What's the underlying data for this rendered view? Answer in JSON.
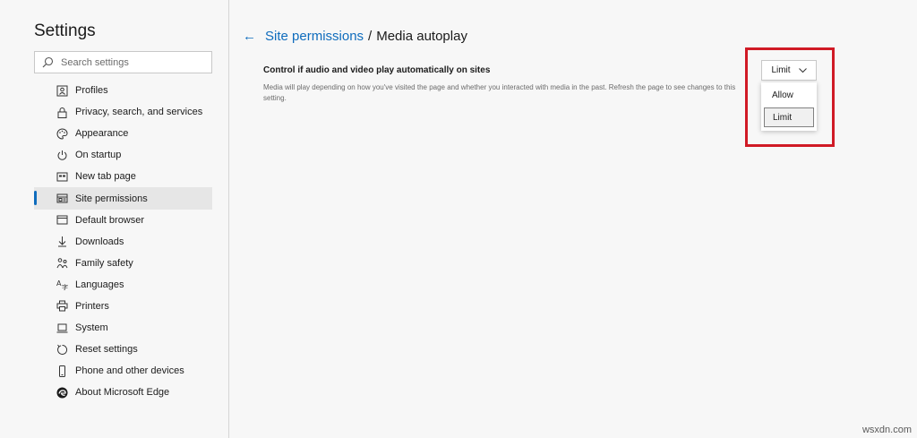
{
  "sidebar": {
    "title": "Settings",
    "search": {
      "placeholder": "Search settings",
      "icon": "search-icon"
    },
    "items": [
      {
        "label": "Profiles",
        "icon": "profile-icon",
        "active": false
      },
      {
        "label": "Privacy, search, and services",
        "icon": "lock-icon",
        "active": false
      },
      {
        "label": "Appearance",
        "icon": "palette-icon",
        "active": false
      },
      {
        "label": "On startup",
        "icon": "power-icon",
        "active": false
      },
      {
        "label": "New tab page",
        "icon": "new-tab-icon",
        "active": false
      },
      {
        "label": "Site permissions",
        "icon": "site-permissions-icon",
        "active": true
      },
      {
        "label": "Default browser",
        "icon": "browser-icon",
        "active": false
      },
      {
        "label": "Downloads",
        "icon": "download-icon",
        "active": false
      },
      {
        "label": "Family safety",
        "icon": "family-icon",
        "active": false
      },
      {
        "label": "Languages",
        "icon": "languages-icon",
        "active": false
      },
      {
        "label": "Printers",
        "icon": "printer-icon",
        "active": false
      },
      {
        "label": "System",
        "icon": "system-icon",
        "active": false
      },
      {
        "label": "Reset settings",
        "icon": "reset-icon",
        "active": false
      },
      {
        "label": "Phone and other devices",
        "icon": "phone-icon",
        "active": false
      },
      {
        "label": "About Microsoft Edge",
        "icon": "edge-icon",
        "active": false
      }
    ]
  },
  "header": {
    "back_icon": "back-arrow-icon",
    "parent": "Site permissions",
    "separator": "/",
    "current": "Media autoplay"
  },
  "setting": {
    "title": "Control if audio and video play automatically on sites",
    "description": "Media will play depending on how you've visited the page and whether you interacted with media in the past. Refresh the page to see changes to this setting.",
    "selected": "Limit",
    "options": [
      "Allow",
      "Limit"
    ]
  },
  "watermark": "wsxdn.com",
  "colors": {
    "accent": "#0f6cbd",
    "highlight": "#d01a25",
    "background": "#f7f7f7"
  }
}
